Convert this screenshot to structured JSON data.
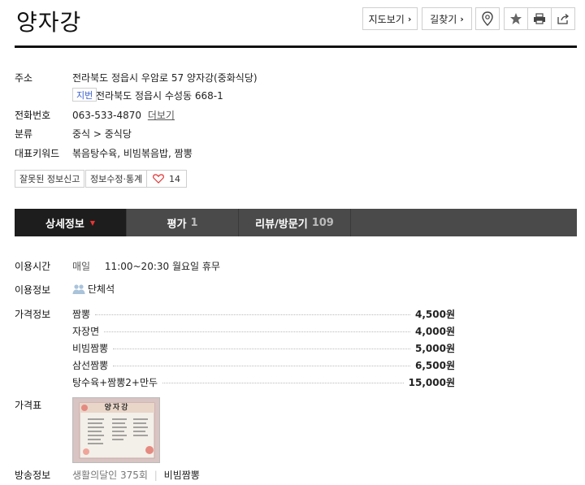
{
  "place": {
    "name": "양자강"
  },
  "top_buttons": {
    "map": "지도보기",
    "directions": "길찾기"
  },
  "info": {
    "address_label": "주소",
    "address": "전라북도 정읍시 우암로 57 양자강(중화식당)",
    "jibun_tag": "지번",
    "jibun_address": "전라북도 정읍시 수성동 668-1",
    "phone_label": "전화번호",
    "phone": "063-533-4870",
    "phone_more": "더보기",
    "category_label": "분류",
    "category": "중식 > 중식당",
    "keywords_label": "대표키워드",
    "keywords": "볶음탕수육, 비빔볶음밥, 짬뽕"
  },
  "actions": {
    "report": "잘못된 정보신고",
    "edit": "정보수정·통계",
    "likes": "14"
  },
  "tabs": [
    {
      "label": "상세정보",
      "count": ""
    },
    {
      "label": "평가",
      "count": "1"
    },
    {
      "label": "리뷰/방문기",
      "count": "109"
    }
  ],
  "details": {
    "hours_label": "이용시간",
    "hours_day": "매일",
    "hours_value": "11:00~20:30 월요일 휴무",
    "usage_label": "이용정보",
    "usage_value": "단체석",
    "price_label": "가격정보",
    "prices": [
      {
        "name": "짬뽕",
        "price": "4,500원"
      },
      {
        "name": "자장면",
        "price": "4,000원"
      },
      {
        "name": "비빔짬뽕",
        "price": "5,000원"
      },
      {
        "name": "삼선짬뽕",
        "price": "6,500원"
      },
      {
        "name": "탕수육+짬뽕2+만두",
        "price": "15,000원"
      }
    ],
    "price_table_label": "가격표",
    "menu_board_title": "양자강",
    "broadcast_label": "방송정보",
    "broadcast_show": "생활의달인 375회",
    "broadcast_item": "비빔짬뽕"
  },
  "colors": {
    "accent_red": "#e33333",
    "tab_bg": "#4a4a4a",
    "tab_active": "#1d1d1d",
    "link_blue": "#3a5fcd"
  }
}
